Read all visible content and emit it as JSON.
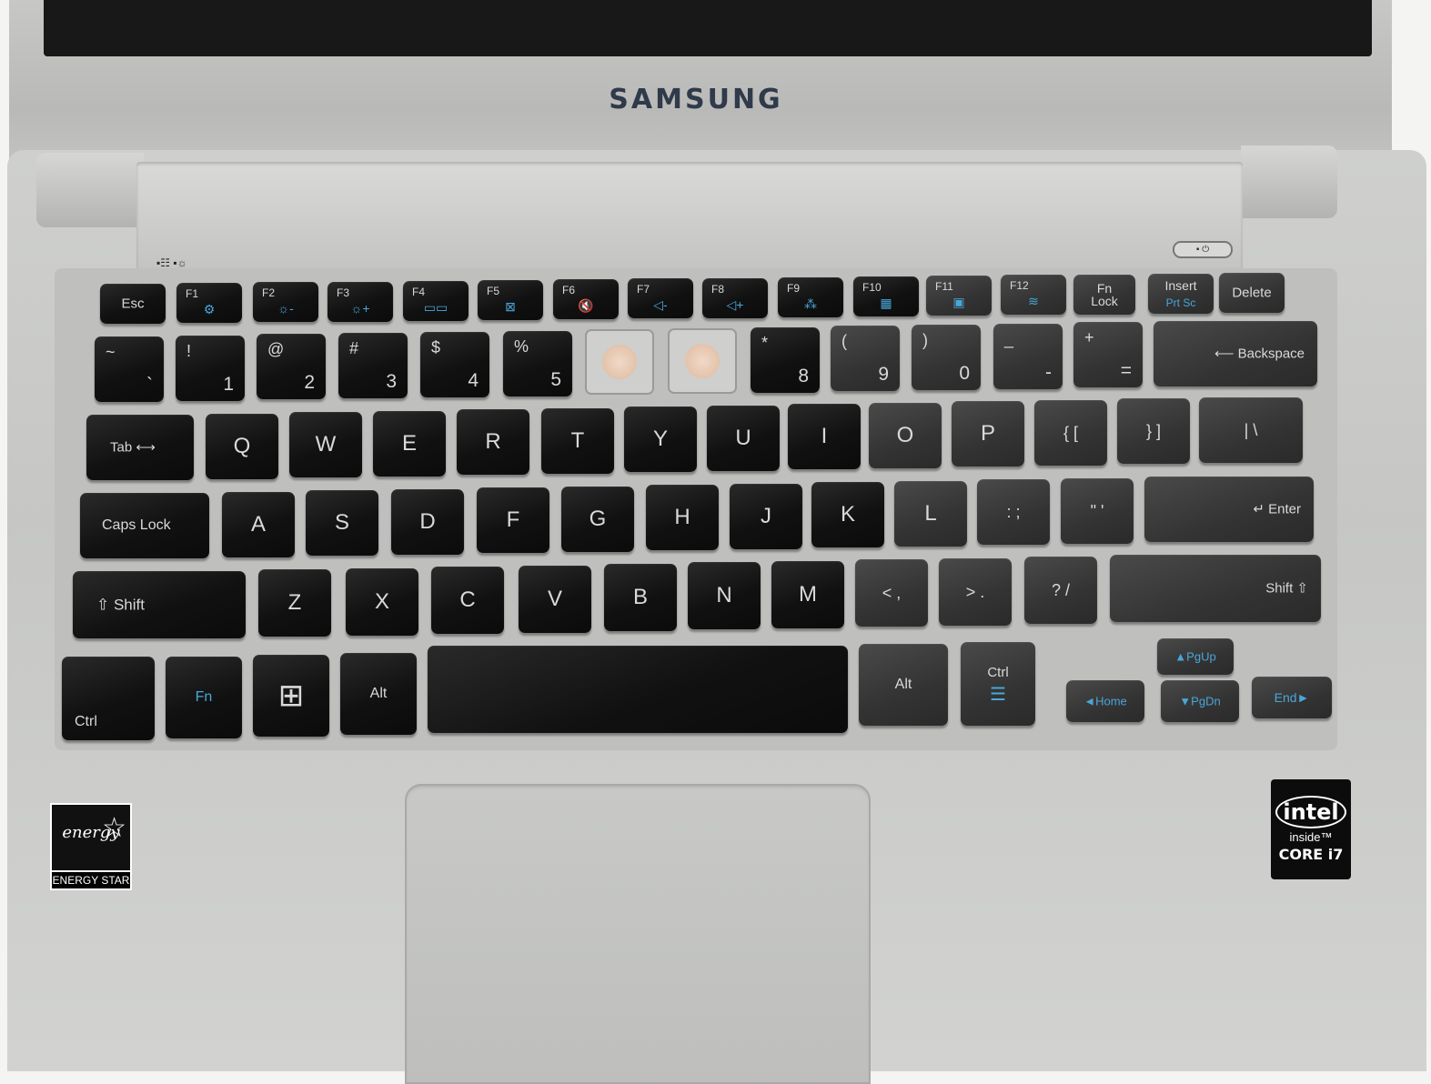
{
  "brand": "SAMSUNG",
  "status_leds": "▪☷ ▪☼",
  "power_symbol": "▪ ⏻",
  "function_row": [
    {
      "main": "Esc",
      "sub": ""
    },
    {
      "main": "F1",
      "sub": "⚙"
    },
    {
      "main": "F2",
      "sub": "☼-"
    },
    {
      "main": "F3",
      "sub": "☼+"
    },
    {
      "main": "F4",
      "sub": "▭▭"
    },
    {
      "main": "F5",
      "sub": "⊠"
    },
    {
      "main": "F6",
      "sub": "🔇"
    },
    {
      "main": "F7",
      "sub": "◁-"
    },
    {
      "main": "F8",
      "sub": "◁+"
    },
    {
      "main": "F9",
      "sub": "⁂"
    },
    {
      "main": "F10",
      "sub": "▦"
    },
    {
      "main": "F11",
      "sub": "▣"
    },
    {
      "main": "F12",
      "sub": "≋"
    },
    {
      "main": "Fn Lock",
      "sub": ""
    },
    {
      "main": "Insert",
      "sub": "Prt Sc"
    },
    {
      "main": "Delete",
      "sub": ""
    }
  ],
  "number_row": [
    {
      "top": "~",
      "bottom": "`"
    },
    {
      "top": "!",
      "bottom": "1"
    },
    {
      "top": "@",
      "bottom": "2"
    },
    {
      "top": "#",
      "bottom": "3"
    },
    {
      "top": "$",
      "bottom": "4"
    },
    {
      "top": "%",
      "bottom": "5"
    },
    {
      "top": "",
      "bottom": ""
    },
    {
      "top": "",
      "bottom": ""
    },
    {
      "top": "*",
      "bottom": "8"
    },
    {
      "top": "(",
      "bottom": "9"
    },
    {
      "top": ")",
      "bottom": "0"
    },
    {
      "top": "_",
      "bottom": "-"
    },
    {
      "top": "+",
      "bottom": "="
    },
    {
      "top": "",
      "bottom": "⟵ Backspace"
    }
  ],
  "qwerty_row": [
    "Tab ⟷",
    "Q",
    "W",
    "E",
    "R",
    "T",
    "Y",
    "U",
    "I",
    "O",
    "P",
    "{ [",
    "} ]",
    "| \\"
  ],
  "home_row": [
    "Caps Lock",
    "A",
    "S",
    "D",
    "F",
    "G",
    "H",
    "J",
    "K",
    "L",
    ": ;",
    "\" '",
    "↵ Enter"
  ],
  "shift_row": [
    "⇧ Shift",
    "Z",
    "X",
    "C",
    "V",
    "B",
    "N",
    "M",
    "< ,",
    "> .",
    "? /",
    "Shift ⇧"
  ],
  "bottom_row": {
    "ctrl_left": "Ctrl",
    "fn": "Fn",
    "win": "⊞",
    "alt_left": "Alt",
    "space": "",
    "alt_right": "Alt",
    "ctrl_right": "Ctrl",
    "menu_icon": "☰",
    "pgup": "▲PgUp",
    "pgdn": "▼PgDn",
    "home": "◄Home",
    "end": "End►"
  },
  "stickers": {
    "energy_script": "energy",
    "energy_star": "☆",
    "energy_label": "ENERGY STAR",
    "intel_logo": "intel",
    "intel_inside": "inside™",
    "intel_core": "CORE i7"
  }
}
